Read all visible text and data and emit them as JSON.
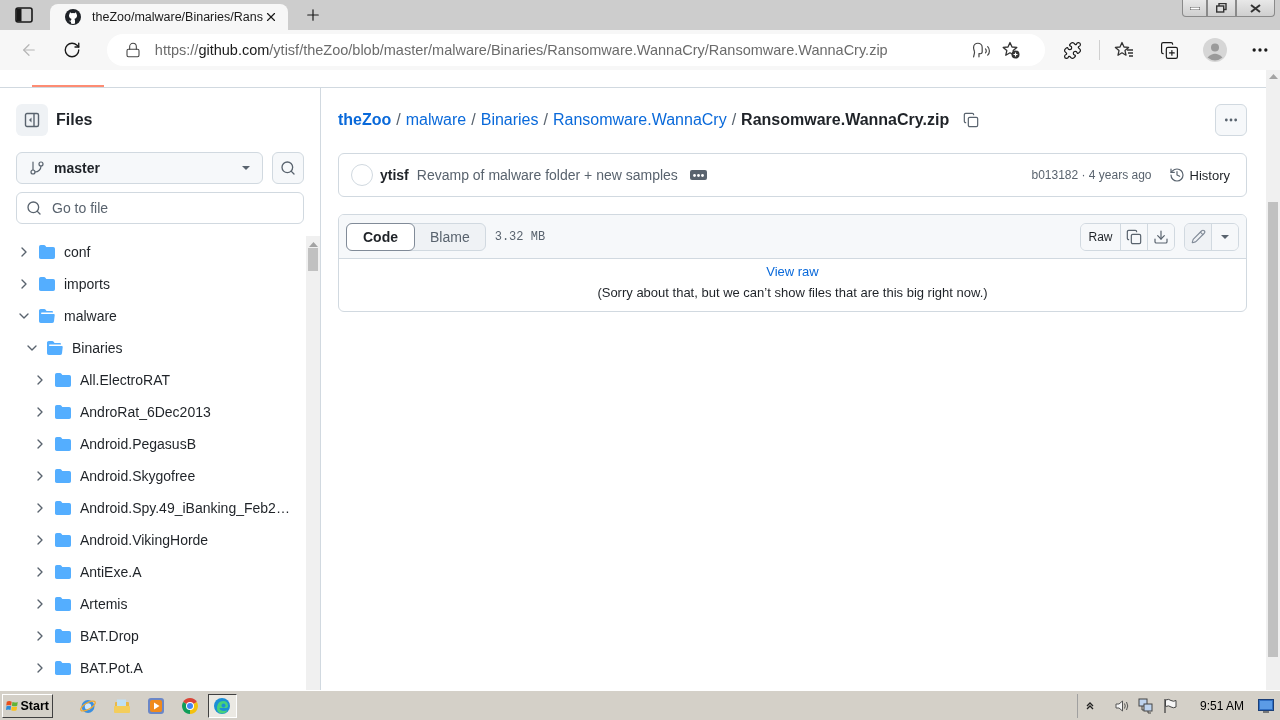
{
  "browser": {
    "tabs": [
      {
        "title": "theZoo/malware/Binaries/Rans",
        "selected": true
      }
    ],
    "address": "https://github.com/ytisf/theZoo/blob/master/malware/Binaries/Ransomware.WannaCry/Ransomware.WannaCry.zip"
  },
  "sidebar": {
    "title": "Files",
    "branch": "master",
    "file_search": {
      "placeholder": "Go to file"
    },
    "tree": [
      {
        "name": "conf",
        "expanded": false
      },
      {
        "name": "imports",
        "expanded": false
      },
      {
        "name": "malware",
        "expanded": true,
        "children": [
          {
            "name": "Binaries",
            "expanded": true,
            "children": [
              {
                "name": "All.ElectroRAT",
                "expanded": false
              },
              {
                "name": "AndroRat_6Dec2013",
                "expanded": false
              },
              {
                "name": "Android.PegasusB",
                "expanded": false
              },
              {
                "name": "Android.Skygofree",
                "expanded": false
              },
              {
                "name": "Android.Spy.49_iBanking_Feb2…",
                "expanded": false
              },
              {
                "name": "Android.VikingHorde",
                "expanded": false
              },
              {
                "name": "AntiExe.A",
                "expanded": false
              },
              {
                "name": "Artemis",
                "expanded": false
              },
              {
                "name": "BAT.Drop",
                "expanded": false
              },
              {
                "name": "BAT.Pot.A",
                "expanded": false
              }
            ]
          }
        ]
      }
    ]
  },
  "breadcrumb": {
    "links": [
      {
        "label": "theZoo",
        "separator": "/"
      },
      {
        "label": "malware",
        "separator": "/"
      },
      {
        "label": "Binaries",
        "separator": "/"
      },
      {
        "label": "Ransomware.WannaCry",
        "separator": "/"
      }
    ],
    "current": "Ransomware.WannaCry.zip"
  },
  "commit": {
    "author": "ytisf",
    "message": "Revamp of malware folder + new samples",
    "meta": "b013182 · 4 years ago",
    "history": "History"
  },
  "file": {
    "views": [
      {
        "label": "Code",
        "selected": true
      },
      {
        "label": "Blame",
        "selected": false
      }
    ],
    "size": "3.32 MB",
    "raw": "Raw",
    "view_raw": "View raw",
    "notice": "(Sorry about that, but we can’t show files that are this big right now.)"
  },
  "taskbar": {
    "start": "Start",
    "apps": [
      {
        "kind": "ie",
        "selected": false
      },
      {
        "kind": "explorer",
        "selected": false
      },
      {
        "kind": "media",
        "selected": false
      },
      {
        "kind": "chrome",
        "selected": false
      },
      {
        "kind": "edge",
        "selected": true
      }
    ],
    "clock": "9:51 AM"
  }
}
